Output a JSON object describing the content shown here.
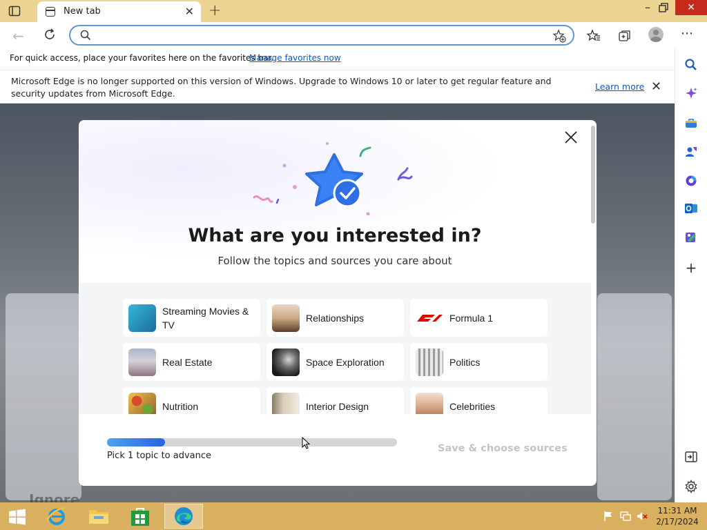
{
  "browser": {
    "tab_title": "New tab",
    "address_value": "",
    "address_placeholder": "",
    "favbar_text": "For quick access, place your favorites here on the favorites bar.",
    "favbar_link": "Manage favorites now",
    "infobar_message": "Microsoft Edge is no longer supported on this version of Windows. Upgrade to Windows 10 or later to get regular feature and security updates from Microsoft Edge.",
    "infobar_link": "Learn more"
  },
  "page": {
    "background_text": "Ignore"
  },
  "modal": {
    "title": "What are you interested in?",
    "subtitle": "Follow the topics and sources you care about",
    "topics": [
      {
        "label": "Streaming Movies & TV",
        "icon": "streaming-thumb",
        "color": "#2a9fc9"
      },
      {
        "label": "Relationships",
        "icon": "relationships-thumb",
        "color": "#8c6a4e"
      },
      {
        "label": "Formula 1",
        "icon": "formula1-logo",
        "color": "#e10600"
      },
      {
        "label": "Real Estate",
        "icon": "real-estate-thumb",
        "color": "#9a8fa1"
      },
      {
        "label": "Space Exploration",
        "icon": "space-thumb",
        "color": "#3a3a3a"
      },
      {
        "label": "Politics",
        "icon": "politics-thumb",
        "color": "#8f8f8f"
      },
      {
        "label": "Nutrition",
        "icon": "nutrition-thumb",
        "color": "#b8802c"
      },
      {
        "label": "Interior Design",
        "icon": "interior-thumb",
        "color": "#b7a893"
      },
      {
        "label": "Celebrities",
        "icon": "celebrities-thumb",
        "color": "#c99a7a"
      }
    ],
    "progress_fraction": 0.2,
    "progress_text": "Pick 1 topic to advance",
    "save_label": "Save & choose sources"
  },
  "taskbar": {
    "apps": [
      "internet-explorer",
      "file-explorer",
      "store",
      "edge"
    ],
    "time": "11:31 AM",
    "date": "2/17/2024"
  },
  "colors": {
    "accent": "#0b57d0",
    "titlebar": "#ecd493",
    "taskbar": "#d8b060"
  }
}
